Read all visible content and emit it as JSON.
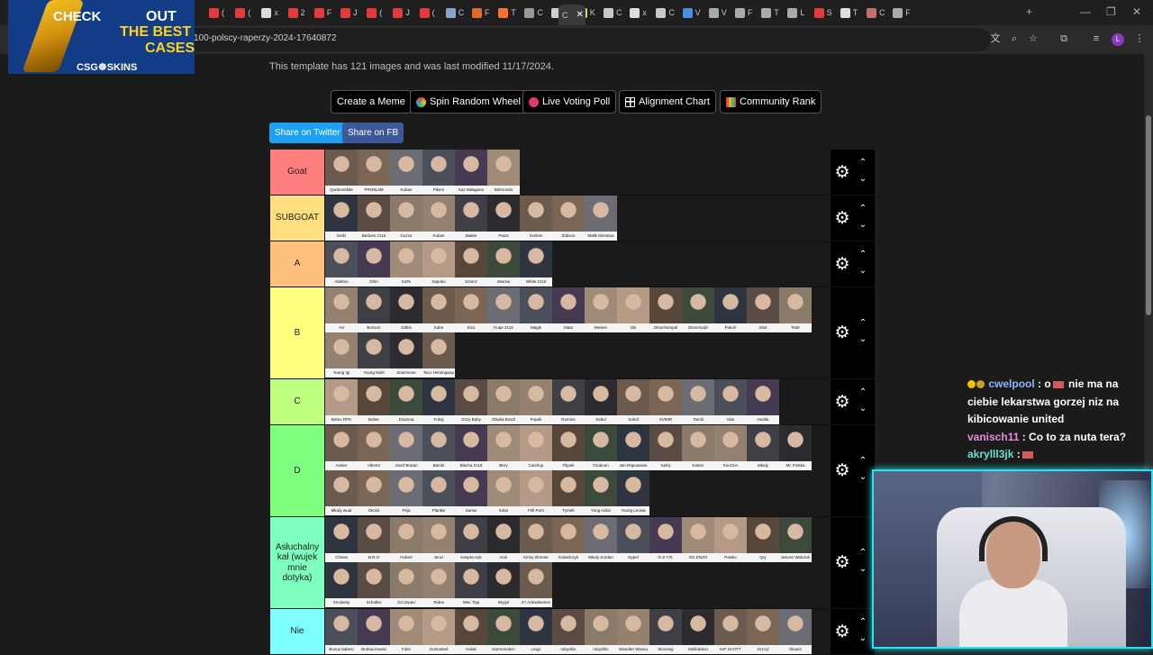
{
  "browser": {
    "url": "100-polscy-raperzy-2024-17640872",
    "tabs": [
      {
        "icon": "youtube-icon",
        "label": "(",
        "color": "#e33b3b"
      },
      {
        "icon": "youtube-icon",
        "label": "(",
        "color": "#e33b3b"
      },
      {
        "icon": "x-icon",
        "label": "x",
        "color": "#dddddd"
      },
      {
        "icon": "youtube-icon",
        "label": "2",
        "color": "#e33b3b"
      },
      {
        "icon": "youtube-icon",
        "label": "F",
        "color": "#e33b3b"
      },
      {
        "icon": "youtube-icon",
        "label": "J",
        "color": "#e33b3b"
      },
      {
        "icon": "youtube-icon",
        "label": "(",
        "color": "#e33b3b"
      },
      {
        "icon": "youtube-icon",
        "label": "J",
        "color": "#e33b3b"
      },
      {
        "icon": "youtube-icon",
        "label": "(",
        "color": "#e33b3b"
      },
      {
        "icon": "globe-icon",
        "label": "C",
        "color": "#8aa3c9"
      },
      {
        "icon": "flag-icon",
        "label": "F",
        "color": "#e36a2b"
      },
      {
        "icon": "fire-icon",
        "label": "T",
        "color": "#ff6f31"
      },
      {
        "icon": "page-icon",
        "label": "C",
        "color": "#999999"
      },
      {
        "icon": "imgflip-icon",
        "label": "A",
        "color": "#cfcfcf"
      },
      {
        "icon": "k-icon",
        "label": "K",
        "color": "#c9e36a"
      },
      {
        "icon": "page-icon",
        "label": "C",
        "color": "#c9c9c9"
      },
      {
        "icon": "x-icon",
        "label": "x",
        "color": "#dddddd"
      },
      {
        "icon": "page-icon",
        "label": "C",
        "color": "#c9c9c9"
      },
      {
        "icon": "stats-icon",
        "label": "V",
        "color": "#4a90e2"
      },
      {
        "icon": "globe-icon",
        "label": "V",
        "color": "#aaaaaa"
      },
      {
        "icon": "page-icon",
        "label": "F",
        "color": "#aaaaaa"
      },
      {
        "icon": "page-icon",
        "label": "T",
        "color": "#aaaaaa"
      },
      {
        "icon": "page-icon",
        "label": "L",
        "color": "#aaaaaa"
      },
      {
        "icon": "page-icon",
        "label": "S",
        "color": "#e33b3b"
      },
      {
        "icon": "tiktok-icon",
        "label": "T",
        "color": "#dddddd"
      },
      {
        "icon": "page-icon",
        "label": "C",
        "color": "#c07070"
      },
      {
        "icon": "page-icon",
        "label": "F",
        "color": "#aaaaaa"
      }
    ],
    "active_tab_label": "C",
    "profile_initial": "L"
  },
  "ad": {
    "line1": "CHECK",
    "line2": "OUT",
    "line3": "THE BEST",
    "line4": "CASES",
    "brand": "CSG☸SKINS"
  },
  "page": {
    "info": "This template has 121 images and was last modified 11/17/2024.",
    "buttons": [
      {
        "label": "Create a Meme",
        "icon": "",
        "color": ""
      },
      {
        "label": "Spin Random Wheel",
        "icon": "wheel-icon",
        "color": "#f39c12"
      },
      {
        "label": "Live Voting Poll",
        "icon": "poll-icon",
        "color": "#e2386b"
      },
      {
        "label": "Alignment Chart",
        "icon": "grid-icon",
        "color": "#ffffff"
      },
      {
        "label": "Community Rank",
        "icon": "rank-icon",
        "color": "#f5a623"
      }
    ],
    "share": [
      {
        "label": "Share on Twitter",
        "color": "#1da1f2"
      },
      {
        "label": "Share on FB",
        "color": "#3b5998"
      }
    ]
  },
  "tiers": [
    {
      "label": "Goat",
      "color": "#ff7f7f",
      "items": [
        "Quebonafide",
        "PRO8L3M",
        "Kuban",
        "Pikers",
        "Kaz Bałagane",
        "Belmondo"
      ]
    },
    {
      "label": "SUBGOAT",
      "color": "#ffdf7f",
      "items": [
        "Gedz",
        "Bedoes 2115",
        "Guzior",
        "Kuban",
        "Białas",
        "Paszt",
        "Szekim",
        "Żabson",
        "Małik Montana"
      ]
    },
    {
      "label": "A",
      "color": "#ffbf7f",
      "items": [
        "Abelton",
        "Dihn",
        "KaTe",
        "Sapoko",
        "Szamz",
        "Wwmw",
        "White 2115"
      ]
    },
    {
      "label": "B",
      "color": "#ffff7f",
      "items": [
        "Avi",
        "Borixon",
        "Gibbs",
        "Kabe",
        "Kizo",
        "Kuqe 2115",
        "Magik",
        "Mata",
        "Mesiec",
        "Oki",
        "Otsochampel",
        "Otsochodzi",
        "Pokoh",
        "Sliot",
        "Tede",
        "Young Igi",
        "Young Multi",
        "Zeamsone",
        "Taco Hemingway"
      ]
    },
    {
      "label": "C",
      "color": "#bfff7f",
      "items": [
        "Beteo RPK",
        "Bober",
        "Dziarma",
        "Fukaj",
        "Ozzy Baby",
        "Oliwka Brazil",
        "Popek",
        "Rumine",
        "Sebel",
        "Sokół",
        "SVM!R",
        "Tamili",
        "Vkie",
        "Hodak"
      ]
    },
    {
      "label": "D",
      "color": "#7fff7f",
      "items": [
        "Asster",
        "Alberto",
        "Josef Bratan",
        "Bambi",
        "Blacha 2115",
        "Bery",
        "Catchup",
        "Filipek",
        "Gruboon",
        "Jan-Rapowanie",
        "KęKę",
        "Kaster",
        "Konzzer",
        "Młody",
        "Mr. Polska",
        "Młody wuat",
        "Okolol",
        "Peja",
        "PlanBe",
        "Sarius",
        "Solar",
        "Frill Porn",
        "Tymek",
        "Yung Adisz",
        "Young Leosia"
      ]
    },
    {
      "label": "Asłuchalny kał (wujek mnie dotyka)",
      "color": "#7fffbf",
      "items": [
        "Chivas",
        "B.R.O",
        "Hubert",
        "Jeruz",
        "Kasperczyk",
        "Kali",
        "Kinny Zimmer",
        "Kubańczyk",
        "Młody Kordan",
        "Nypel",
        "O.S.T.R.",
        "OG ENZO",
        "Pawko",
        "Qry",
        "Janusz Walczuk",
        "Smolasty",
        "Schafter",
        "Szczepan",
        "Tedeo",
        "Wac Toja",
        "Wygol",
        "27.Anksdetones"
      ]
    },
    {
      "label": "Nie",
      "color": "#7fffff",
      "items": [
        "Bonus babesi",
        "Brokaczewski",
        "Fukir",
        "Gortosteel",
        "Holak",
        "Harmonobec",
        "Lingo",
        "rubydiliA",
        "rubydiliA",
        "Wandter Wassa",
        "Monsieg",
        "Molibdaton",
        "KIP SCOTT",
        "Szczyl",
        "Skauts"
      ]
    }
  ],
  "chat": [
    {
      "user": "cwelpool",
      "user_color": "#8fb4ff",
      "text": ": o",
      "text2": "nie ma na ciebie lekarstwa gorzej niz na kibicowanie united",
      "badges": true
    },
    {
      "user": "vanisch11",
      "user_color": "#e78be0",
      "text": ": Co to za nuta tera?",
      "text2": "",
      "badges": false
    },
    {
      "user": "akrylll3jk",
      "user_color": "#6de0cc",
      "text": ":",
      "text2": "",
      "badges": false
    }
  ],
  "icons": {
    "gear": "gear-icon",
    "up": "chevron-up-icon",
    "down": "chevron-down-icon"
  }
}
